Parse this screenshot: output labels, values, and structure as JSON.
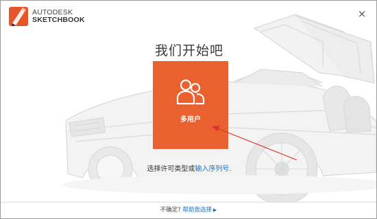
{
  "app": {
    "brand_line1": "AUTODESK",
    "brand_line2": "SKETCHBOOK",
    "close_label": "×"
  },
  "main": {
    "heading": "我们开始吧",
    "tile_label": "多用户",
    "subline_prefix": "选择许可类型或",
    "subline_link": "输入序列号",
    "subline_suffix": "."
  },
  "footer": {
    "prefix": "不确定?",
    "link": "帮助我选择",
    "arrow": "▶"
  },
  "colors": {
    "accent": "#e8612e",
    "link": "#1a73c9",
    "annotation": "#d9342b"
  }
}
